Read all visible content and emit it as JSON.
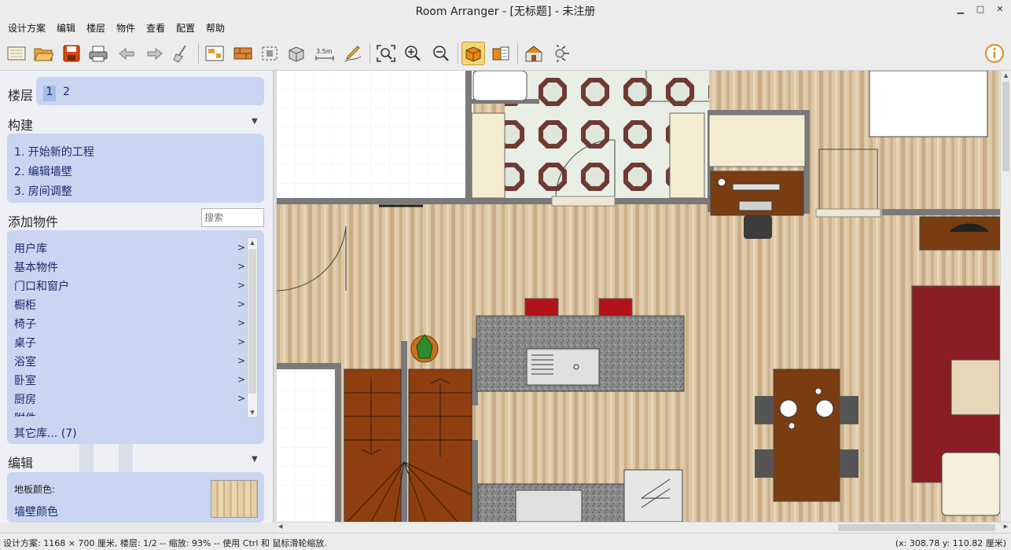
{
  "window": {
    "title": "Room Arranger - [无标题] - 未注册",
    "minimize": "▁",
    "maximize": "□",
    "close": "✕"
  },
  "menu": [
    "设计方案",
    "编辑",
    "楼层",
    "物件",
    "查看",
    "配置",
    "帮助"
  ],
  "toolbar": {
    "icons": [
      "new-plan-icon",
      "open-icon",
      "save-icon",
      "print-icon",
      "undo-icon",
      "redo-icon",
      "clean-icon",
      "floor-plan-icon",
      "wall-icon",
      "select-icon",
      "3d-object-icon",
      "measure-icon",
      "pencil-icon",
      "zoom-fit-icon",
      "zoom-in-icon",
      "zoom-out-icon",
      "2d-view-icon",
      "3d-view-icon",
      "house-3d-icon",
      "render-icon",
      "info-icon"
    ],
    "measure_label": "3.5m"
  },
  "left": {
    "floors_label": "楼层",
    "floors": [
      "1",
      "2"
    ],
    "build_label": "构建",
    "build_items": [
      "1. 开始新的工程",
      "2. 编辑墙壁",
      "3. 房间调整"
    ],
    "add_label": "添加物件",
    "search_placeholder": "搜索",
    "categories": [
      "用户库",
      "基本物件",
      "门口和窗户",
      "橱柜",
      "椅子",
      "桌子",
      "浴室",
      "卧室",
      "厨房",
      "附件"
    ],
    "more_libs": "其它库... (7)",
    "edit_label": "编辑",
    "floor_color_label": "地板颜色:",
    "wall_color_label": "墙壁颜色"
  },
  "colors": {
    "panel_box": "#c9d5f1",
    "floor_wood": "#d8c4a4",
    "wall": "#7a7a7a",
    "rug": "#8b1e24",
    "table": "#7a3d12"
  },
  "status": {
    "left": "设计方案: 1168 × 700 厘米, 楼层: 1/2 -- 缩放: 93% -- 使用 Ctrl 和 鼠标滑轮缩放.",
    "right": "(x: 308.78 y: 110.82 厘米)"
  }
}
